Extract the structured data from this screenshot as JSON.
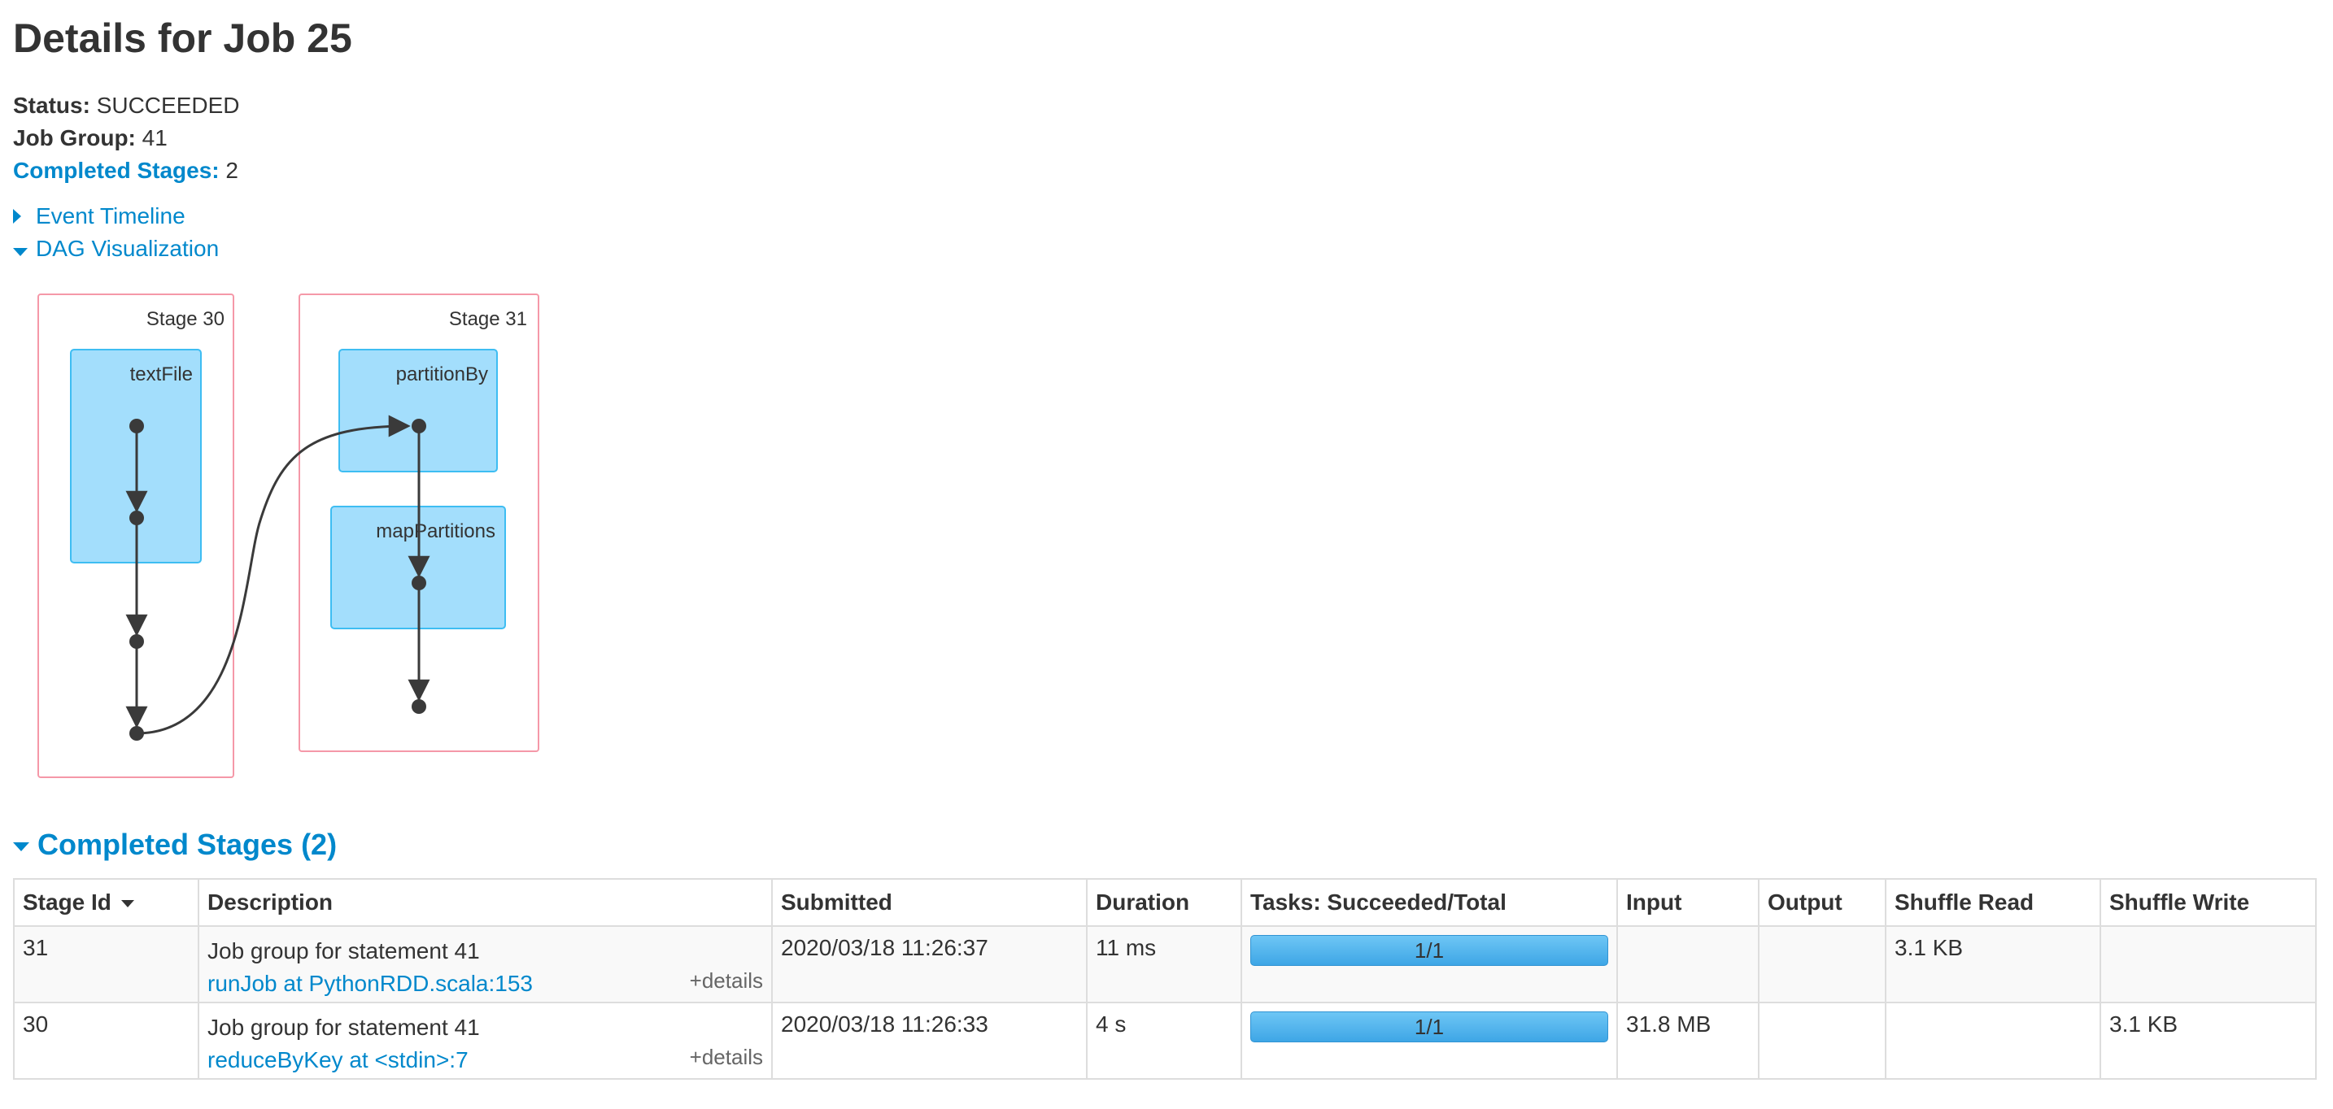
{
  "page": {
    "title": "Details for Job 25"
  },
  "summary": {
    "status_label": "Status:",
    "status_value": "SUCCEEDED",
    "job_group_label": "Job Group:",
    "job_group_value": "41",
    "completed_stages_label": "Completed Stages:",
    "completed_stages_value": "2"
  },
  "toggles": {
    "event_timeline": "Event Timeline",
    "dag_visualization": "DAG Visualization"
  },
  "dag": {
    "stages": [
      {
        "label": "Stage 30",
        "clusters": [
          "textFile"
        ]
      },
      {
        "label": "Stage 31",
        "clusters": [
          "partitionBy",
          "mapPartitions"
        ]
      }
    ],
    "colors": {
      "stage_border": "#f598a8",
      "cluster_fill": "#a3defc",
      "cluster_border": "#3ebdf2",
      "node": "#3a3a3a"
    }
  },
  "completed_section": {
    "heading": "Completed Stages (2)"
  },
  "table": {
    "headers": [
      "Stage Id",
      "Description",
      "Submitted",
      "Duration",
      "Tasks: Succeeded/Total",
      "Input",
      "Output",
      "Shuffle Read",
      "Shuffle Write"
    ],
    "rows": [
      {
        "stage_id": "31",
        "description": "Job group for statement 41",
        "link": "runJob at PythonRDD.scala:153",
        "details": "+details",
        "submitted": "2020/03/18 11:26:37",
        "duration": "11 ms",
        "tasks": "1/1",
        "tasks_fraction": 1.0,
        "input": "",
        "output": "",
        "shuffle_read": "3.1 KB",
        "shuffle_write": ""
      },
      {
        "stage_id": "30",
        "description": "Job group for statement 41",
        "link": "reduceByKey at <stdin>:7",
        "details": "+details",
        "submitted": "2020/03/18 11:26:33",
        "duration": "4 s",
        "tasks": "1/1",
        "tasks_fraction": 1.0,
        "input": "31.8 MB",
        "output": "",
        "shuffle_read": "",
        "shuffle_write": "3.1 KB"
      }
    ]
  }
}
